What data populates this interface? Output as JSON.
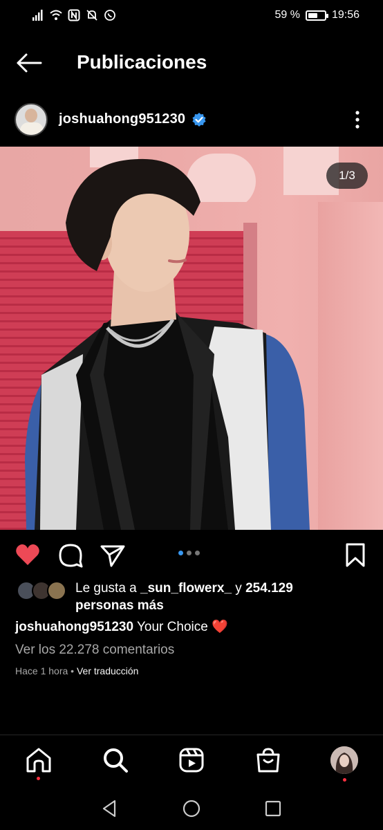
{
  "status_bar": {
    "battery_percent": "59 %",
    "battery_level": 0.59,
    "time": "19:56",
    "icons": [
      "signal-icon",
      "wifi-icon",
      "nfc-icon",
      "mute-icon",
      "whatsapp-icon"
    ]
  },
  "header": {
    "title": "Publicaciones",
    "back_icon": "arrow-left-icon"
  },
  "post": {
    "username": "joshuahong951230",
    "verified": true,
    "image_counter": "1/3",
    "carousel_count": 3,
    "carousel_active": 0,
    "liked": true,
    "likes_prefix": "Le gusta a ",
    "likes_user": "_sun_flowerx_",
    "likes_middle": " y ",
    "likes_count": "254.129",
    "likes_suffix": "personas más",
    "caption_user": "joshuahong951230",
    "caption_text": " Your Choice ",
    "caption_emoji": "❤️",
    "comments_link": "Ver los 22.278 comentarios",
    "time_ago": "Hace 1 hora",
    "separator": " • ",
    "translate_link": "Ver traducción"
  },
  "bottom_nav": {
    "items": [
      "home-icon",
      "search-icon",
      "reels-icon",
      "shop-icon",
      "profile-avatar"
    ]
  },
  "colors": {
    "accent_blue": "#3897f0",
    "like_red": "#ed4956",
    "notification_red": "#ff3040"
  }
}
